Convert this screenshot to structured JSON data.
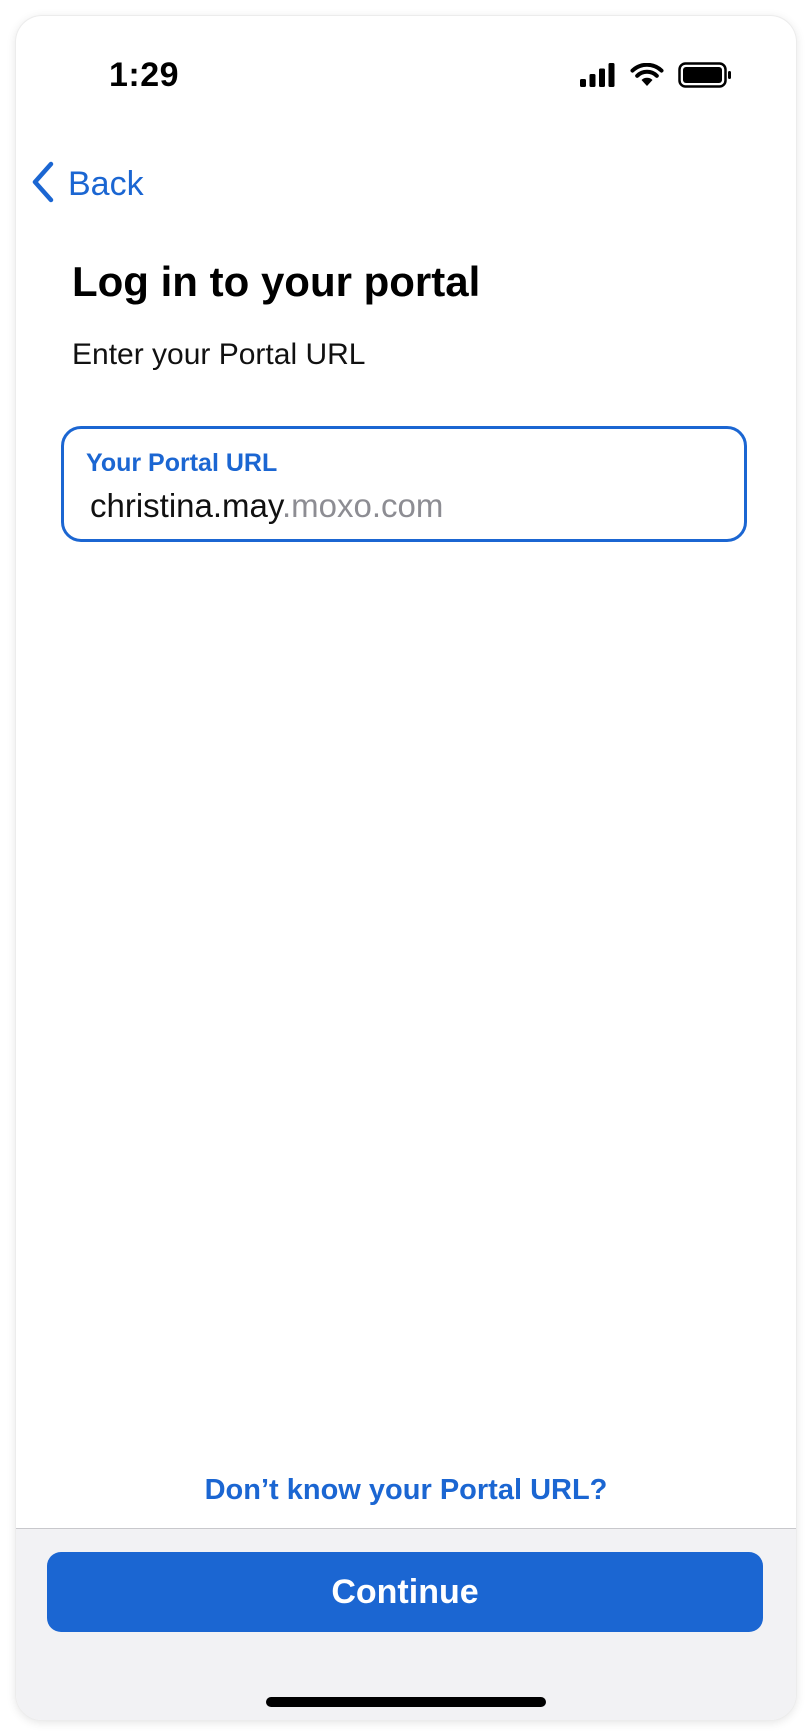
{
  "status_bar": {
    "time": "1:29",
    "icons": [
      "cellular-signal-icon",
      "wifi-icon",
      "battery-icon"
    ]
  },
  "nav": {
    "back_label": "Back",
    "back_icon": "chevron-left-icon"
  },
  "content": {
    "title": "Log in to your portal",
    "subtitle": "Enter your Portal URL",
    "url_field": {
      "label": "Your Portal URL",
      "typed_value": "christina.may",
      "suffix": ".moxo.com"
    },
    "help_link": "Don’t know your Portal URL?"
  },
  "footer": {
    "continue_label": "Continue"
  },
  "colors": {
    "accent": "#1b66d2",
    "suffix_gray": "#8d8d93",
    "footer_bg": "#f2f2f4"
  }
}
